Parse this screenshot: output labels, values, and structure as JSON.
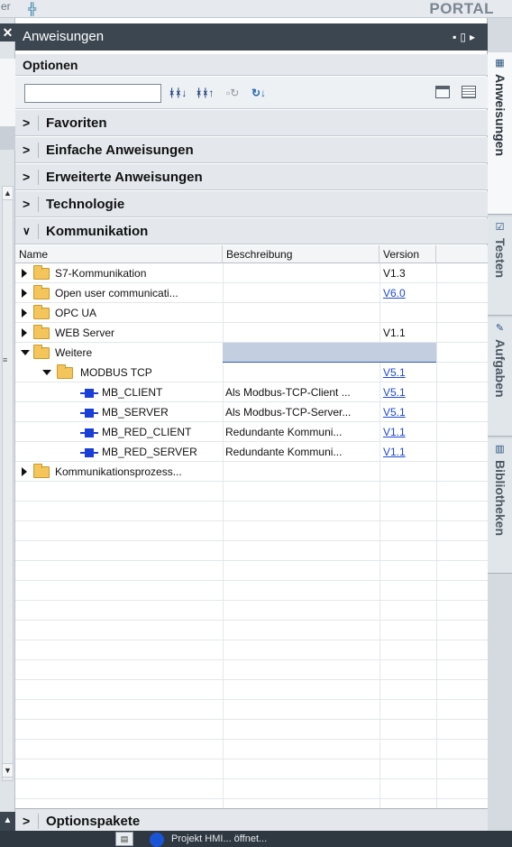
{
  "topbar": {
    "left_text": "er",
    "portal_label": "PORTAL"
  },
  "panel": {
    "title": "Anweisungen",
    "options_label": "Optionen",
    "search": {
      "value": "",
      "placeholder": ""
    },
    "categories": [
      {
        "label": "Favoriten",
        "expanded": false
      },
      {
        "label": "Einfache Anweisungen",
        "expanded": false
      },
      {
        "label": "Erweiterte Anweisungen",
        "expanded": false
      },
      {
        "label": "Technologie",
        "expanded": false
      },
      {
        "label": "Kommunikation",
        "expanded": true
      }
    ],
    "columns": {
      "name": "Name",
      "description": "Beschreibung",
      "version": "Version"
    },
    "rows": [
      {
        "name": "S7-Kommunikation",
        "description": "",
        "version": "V1.3",
        "version_link": false,
        "indent": 0,
        "kind": "folder",
        "expanded": false,
        "selected": false
      },
      {
        "name": "Open user communicati...",
        "description": "",
        "version": "V6.0",
        "version_link": true,
        "indent": 0,
        "kind": "folder",
        "expanded": false,
        "selected": false
      },
      {
        "name": "OPC UA",
        "description": "",
        "version": "",
        "version_link": false,
        "indent": 0,
        "kind": "folder",
        "expanded": false,
        "selected": false
      },
      {
        "name": "WEB Server",
        "description": "",
        "version": "V1.1",
        "version_link": false,
        "indent": 0,
        "kind": "folder",
        "expanded": false,
        "selected": false
      },
      {
        "name": "Weitere",
        "description": "",
        "version": "",
        "version_link": false,
        "indent": 0,
        "kind": "folder",
        "expanded": true,
        "selected": true
      },
      {
        "name": "MODBUS TCP",
        "description": "",
        "version": "V5.1",
        "version_link": true,
        "indent": 1,
        "kind": "folder",
        "expanded": true,
        "selected": false
      },
      {
        "name": "MB_CLIENT",
        "description": "Als Modbus-TCP-Client ...",
        "version": "V5.1",
        "version_link": true,
        "indent": 2,
        "kind": "block",
        "selected": false
      },
      {
        "name": "MB_SERVER",
        "description": "Als Modbus-TCP-Server...",
        "version": "V5.1",
        "version_link": true,
        "indent": 2,
        "kind": "block",
        "selected": false
      },
      {
        "name": "MB_RED_CLIENT",
        "description": "Redundante Kommuni...",
        "version": "V1.1",
        "version_link": true,
        "indent": 2,
        "kind": "block",
        "selected": false
      },
      {
        "name": "MB_RED_SERVER",
        "description": "Redundante Kommuni...",
        "version": "V1.1",
        "version_link": true,
        "indent": 2,
        "kind": "block",
        "selected": false
      },
      {
        "name": "Kommunikationsprozess...",
        "description": "",
        "version": "",
        "version_link": false,
        "indent": 0,
        "kind": "folder",
        "expanded": false,
        "selected": false
      }
    ],
    "bottom_category": "Optionspakete"
  },
  "right_tabs": [
    {
      "label": "Anweisungen",
      "active": true
    },
    {
      "label": "Testen",
      "active": false
    },
    {
      "label": "Aufgaben",
      "active": false
    },
    {
      "label": "Bibliotheken",
      "active": false
    }
  ],
  "statusbar": {
    "text": "Projekt HMI... öffnet..."
  },
  "colors": {
    "header_bg": "#3c4650",
    "selected_row": "#c3cee0",
    "link": "#1f49d4",
    "block_icon": "#1a3fd6",
    "folder": "#f3c55a"
  },
  "icons": [
    "collapse-left-icon",
    "find-icon",
    "find-next-icon",
    "compare-icon",
    "refresh-icon",
    "view-simple-icon",
    "view-detail-icon",
    "folder-icon",
    "function-block-icon"
  ]
}
